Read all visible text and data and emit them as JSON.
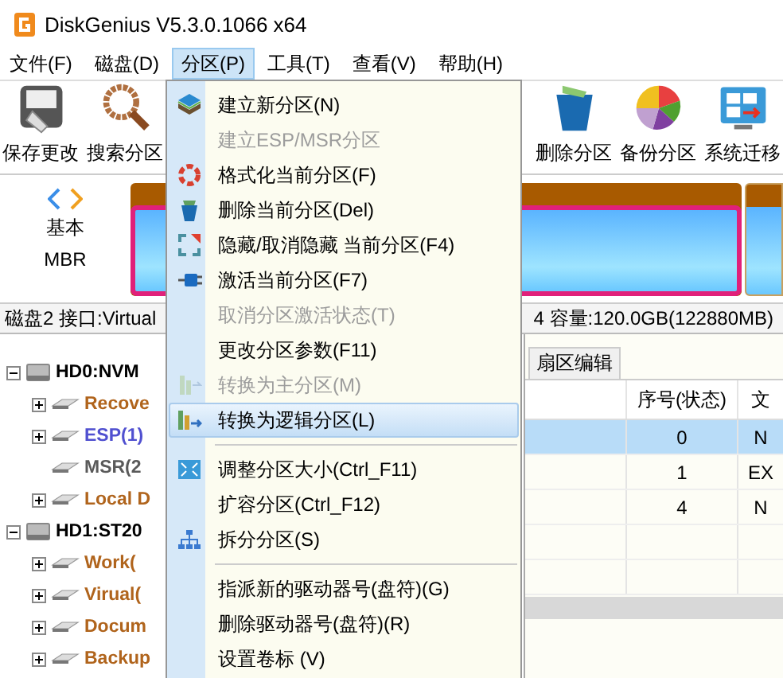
{
  "window": {
    "title": "DiskGenius V5.3.0.1066 x64"
  },
  "menu_bar": [
    {
      "label": "文件(F)",
      "selected": false
    },
    {
      "label": "磁盘(D)",
      "selected": false
    },
    {
      "label": "分区(P)",
      "selected": true
    },
    {
      "label": "工具(T)",
      "selected": false
    },
    {
      "label": "查看(V)",
      "selected": false
    },
    {
      "label": "帮助(H)",
      "selected": false
    }
  ],
  "toolbar": {
    "left": [
      {
        "label": "保存更改",
        "kind": "save"
      },
      {
        "label": "搜索分区",
        "kind": "search"
      }
    ],
    "right": [
      {
        "label": "删除分区",
        "kind": "delete"
      },
      {
        "label": "备份分区",
        "kind": "backup"
      },
      {
        "label": "系统迁移",
        "kind": "migrate"
      }
    ]
  },
  "disk_map": {
    "type_label": "基本",
    "scheme_label": "MBR"
  },
  "info_bar": {
    "left": "磁盘2 接口:Virtual",
    "right": "4  容量:120.0GB(122880MB)"
  },
  "tree": [
    {
      "label": "HD0:NVM",
      "expanded": true,
      "children": [
        {
          "label": "Recove",
          "color": "#b0641c",
          "expanded": false
        },
        {
          "label": "ESP(1)",
          "color": "#5050d0",
          "expanded": false
        },
        {
          "label": "MSR(2",
          "color": "#5a5a5a"
        },
        {
          "label": "Local D",
          "color": "#b0641c",
          "expanded": false
        }
      ]
    },
    {
      "label": "HD1:ST20",
      "expanded": true,
      "children": [
        {
          "label": "Work(",
          "color": "#b0641c",
          "expanded": false
        },
        {
          "label": "Virual(",
          "color": "#b0641c",
          "expanded": false
        },
        {
          "label": "Docum",
          "color": "#b0641c",
          "expanded": false
        },
        {
          "label": "Backup",
          "color": "#b0641c",
          "expanded": false
        }
      ]
    }
  ],
  "tabs": [
    {
      "label": "扇区编辑",
      "selected": false
    }
  ],
  "table": {
    "columns": [
      "序号(状态)",
      "文"
    ],
    "rows": [
      {
        "cells": [
          "0",
          "N"
        ],
        "selected": true
      },
      {
        "cells": [
          "1",
          "EX"
        ],
        "selected": false
      },
      {
        "cells": [
          "4",
          "N"
        ],
        "selected": false
      }
    ]
  },
  "partition_menu": {
    "items": [
      {
        "kind": "item",
        "label": "建立新分区(N)",
        "disabled": false,
        "selected": false
      },
      {
        "kind": "item",
        "label": "建立ESP/MSR分区",
        "disabled": true,
        "selected": false
      },
      {
        "kind": "item",
        "label": "格式化当前分区(F)",
        "disabled": false,
        "selected": false
      },
      {
        "kind": "item",
        "label": "删除当前分区(Del)",
        "disabled": false,
        "selected": false
      },
      {
        "kind": "item",
        "label": "隐藏/取消隐藏 当前分区(F4)",
        "disabled": false,
        "selected": false
      },
      {
        "kind": "item",
        "label": "激活当前分区(F7)",
        "disabled": false,
        "selected": false
      },
      {
        "kind": "item",
        "label": "取消分区激活状态(T)",
        "disabled": true,
        "selected": false
      },
      {
        "kind": "item",
        "label": "更改分区参数(F11)",
        "disabled": false,
        "selected": false
      },
      {
        "kind": "item",
        "label": "转换为主分区(M)",
        "disabled": true,
        "selected": false
      },
      {
        "kind": "item",
        "label": "转换为逻辑分区(L)",
        "disabled": false,
        "selected": true
      },
      {
        "kind": "separator"
      },
      {
        "kind": "item",
        "label": "调整分区大小(Ctrl_F11)",
        "disabled": false,
        "selected": false
      },
      {
        "kind": "item",
        "label": "扩容分区(Ctrl_F12)",
        "disabled": false,
        "selected": false
      },
      {
        "kind": "item",
        "label": "拆分分区(S)",
        "disabled": false,
        "selected": false
      },
      {
        "kind": "separator"
      },
      {
        "kind": "item",
        "label": "指派新的驱动器号(盘符)(G)",
        "disabled": false,
        "selected": false
      },
      {
        "kind": "item",
        "label": "删除驱动器号(盘符)(R)",
        "disabled": false,
        "selected": false
      },
      {
        "kind": "item",
        "label": "设置卷标 (V)",
        "disabled": false,
        "selected": false
      }
    ]
  }
}
